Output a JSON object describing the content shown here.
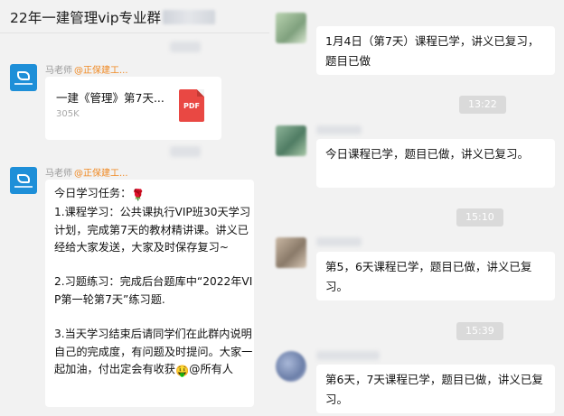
{
  "group": {
    "title": "22年一建管理vip专业群"
  },
  "left_messages": {
    "file": {
      "sender": "马老师",
      "org_tag": "@正保建工...",
      "name": "一建《管理》第7天...",
      "size": "305K",
      "icon_label": "PDF"
    },
    "task": {
      "sender": "马老师",
      "org_tag": "@正保建工...",
      "line1": "今日学习任务：",
      "rose": "🌹",
      "para1": "1.课程学习：公共课执行VIP班30天学习计划，完成第7天的教材精讲课。讲义已经给大家发送，大家及时保存复习~",
      "para2": "2.习题练习：完成后台题库中“2022年VIP第一轮第7天”练习题.",
      "para3a": "3.当天学习结束后请同学们在此群内说明自己的完成度，有问题及时提问。大家一起加油，付出定会有收获",
      "money_emoji": "🤑",
      "para3b": "@所有人"
    }
  },
  "right_messages": {
    "m1": "1月4日（第7天）课程已学，讲义已复习，题目已做",
    "t1": "13:22",
    "m2": "今日课程已学，题目已做，讲义已复习。",
    "t2": "15:10",
    "m3": "第5，6天课程已学，题目已做，讲义已复习。",
    "t3": "15:39",
    "m4": "第6天，7天课程已学，题目已做，讲义已复习。"
  }
}
